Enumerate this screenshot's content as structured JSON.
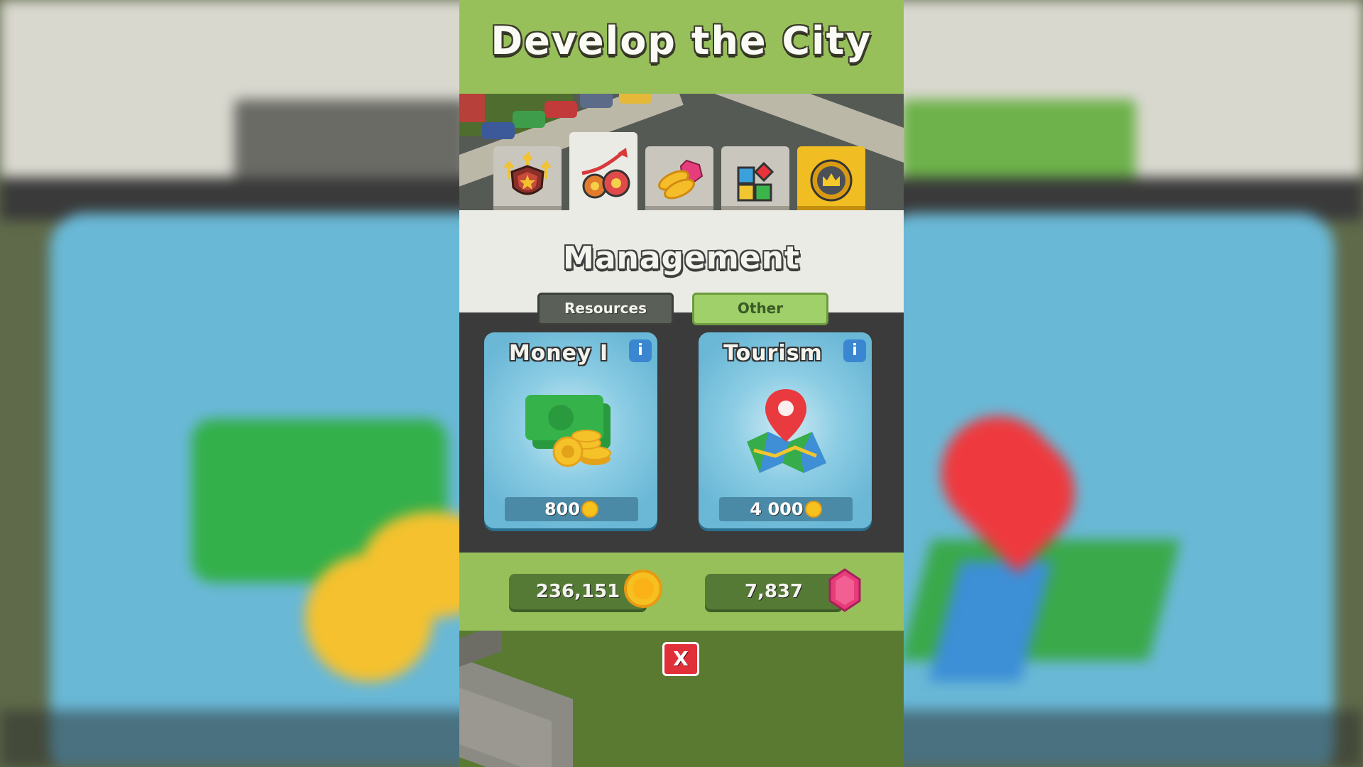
{
  "header": {
    "title": "Develop the City"
  },
  "tabs": [
    {
      "name": "upgrades",
      "icon": "shield-upgrade-icon"
    },
    {
      "name": "management",
      "icon": "gears-growth-icon",
      "active": true
    },
    {
      "name": "shop",
      "icon": "coins-gem-icon"
    },
    {
      "name": "decorations",
      "icon": "color-blocks-icon"
    },
    {
      "name": "premium",
      "icon": "crown-badge-icon"
    }
  ],
  "section": {
    "title": "Management",
    "subtabs": [
      {
        "label": "Resources",
        "selected": false
      },
      {
        "label": "Other",
        "selected": true
      }
    ]
  },
  "cards": [
    {
      "title": "Money I",
      "info_label": "i",
      "price": "800",
      "icon": "money-coins-icon"
    },
    {
      "title": "Tourism",
      "info_label": "i",
      "price": "4 000",
      "icon": "map-pin-icon"
    }
  ],
  "currency": {
    "coins": "236,151",
    "gems": "7,837"
  },
  "close_label": "X",
  "colors": {
    "title_bar": "#97c05a",
    "card_blue": "#6ab7d6",
    "panel_dark": "#3b3b3b",
    "close_red": "#e2303a",
    "premium_gold": "#f0bd22"
  }
}
